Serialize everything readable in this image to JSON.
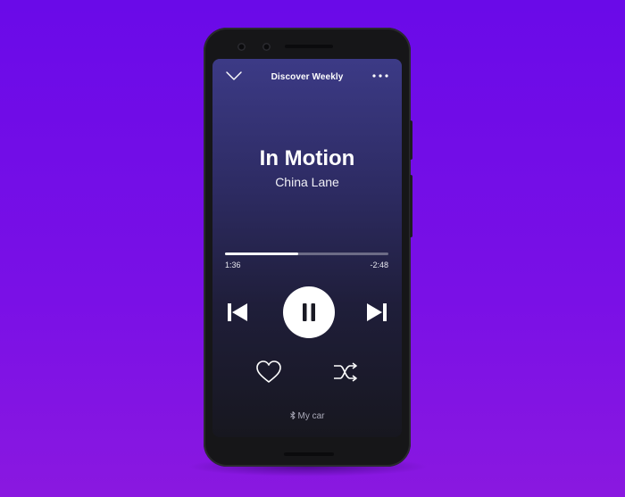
{
  "player": {
    "context_title": "Discover Weekly",
    "song_title": "In Motion",
    "artist": "China Lane",
    "elapsed": "1:36",
    "remaining": "-2:48",
    "progress": 0.45,
    "device_label": "My car",
    "state": "playing"
  },
  "icons": {
    "collapse": "chevron-down-icon",
    "more": "more-options-icon",
    "previous": "skip-previous-icon",
    "play_pause": "pause-icon",
    "next": "skip-next-icon",
    "like": "heart-icon",
    "shuffle": "shuffle-icon",
    "device": "bluetooth-icon"
  },
  "colors": {
    "background": "#6a0ae8",
    "screen_top": "#3c3a86",
    "screen_bottom": "#17171f",
    "accent": "#ffffff"
  }
}
